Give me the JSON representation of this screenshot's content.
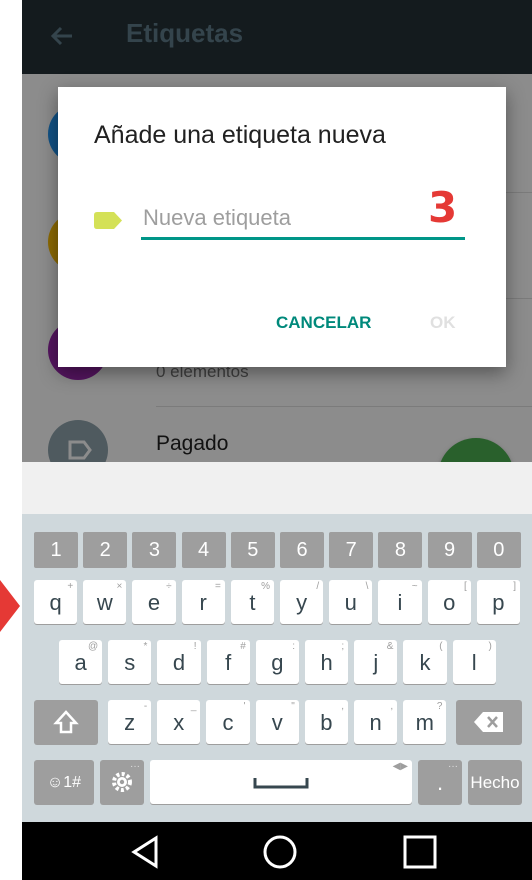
{
  "appbar": {
    "title": "Etiquetas",
    "back_icon": "arrow-back-icon"
  },
  "labels": [
    {
      "name": "",
      "count": "",
      "color": "#2196f3"
    },
    {
      "name": "",
      "count": "",
      "color": "#ffc107"
    },
    {
      "name": "",
      "count": "0 elementos",
      "color": "#9c27b0"
    },
    {
      "name": "Pagado",
      "count": "",
      "color": "#90a4ae"
    }
  ],
  "fab": {
    "icon": "plus-icon",
    "label": "+"
  },
  "dialog": {
    "title": "Añade una etiqueta nueva",
    "input_placeholder": "Nueva etiqueta",
    "input_value": "",
    "tag_icon": "label-icon",
    "tag_color": "#d4e157",
    "counter": "3",
    "cancel_label": "CANCELAR",
    "ok_label": "OK"
  },
  "keyboard": {
    "numbers": [
      "1",
      "2",
      "3",
      "4",
      "5",
      "6",
      "7",
      "8",
      "9",
      "0"
    ],
    "row1": [
      {
        "k": "q",
        "h": "+"
      },
      {
        "k": "w",
        "h": "×"
      },
      {
        "k": "e",
        "h": "÷"
      },
      {
        "k": "r",
        "h": "="
      },
      {
        "k": "t",
        "h": "%"
      },
      {
        "k": "y",
        "h": "/"
      },
      {
        "k": "u",
        "h": "\\"
      },
      {
        "k": "i",
        "h": "~"
      },
      {
        "k": "o",
        "h": "["
      },
      {
        "k": "p",
        "h": "]"
      }
    ],
    "row2": [
      {
        "k": "a",
        "h": "@"
      },
      {
        "k": "s",
        "h": "*"
      },
      {
        "k": "d",
        "h": "!"
      },
      {
        "k": "f",
        "h": "#"
      },
      {
        "k": "g",
        "h": ":"
      },
      {
        "k": "h",
        "h": ";"
      },
      {
        "k": "j",
        "h": "&"
      },
      {
        "k": "k",
        "h": "("
      },
      {
        "k": "l",
        "h": ")"
      }
    ],
    "row3": [
      {
        "k": "z",
        "h": "-"
      },
      {
        "k": "x",
        "h": "_"
      },
      {
        "k": "c",
        "h": "'"
      },
      {
        "k": "v",
        "h": "\""
      },
      {
        "k": "b",
        "h": ","
      },
      {
        "k": "n",
        "h": ","
      },
      {
        "k": "m",
        "h": "?"
      }
    ],
    "symbols_label": "☺1#",
    "settings_icon": "gear-icon",
    "space_icon": "space-bar-icon",
    "period_label": ".",
    "done_label": "Hecho",
    "shift_icon": "shift-icon",
    "backspace_icon": "backspace-icon"
  },
  "navbar": {
    "back_icon": "nav-back-icon",
    "home_icon": "nav-home-icon",
    "recents_icon": "nav-recents-icon"
  },
  "colors": {
    "appbar": "#263238",
    "accent": "#009688",
    "counter": "#e53935",
    "pointer": "#e53935"
  }
}
